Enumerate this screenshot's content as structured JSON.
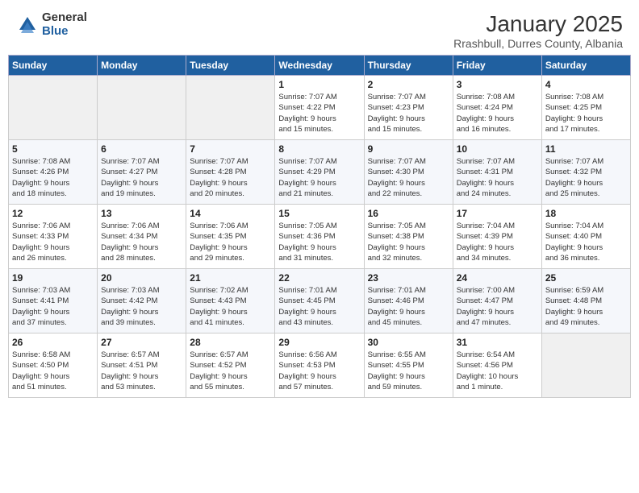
{
  "header": {
    "logo_general": "General",
    "logo_blue": "Blue",
    "month_title": "January 2025",
    "location": "Rrashbull, Durres County, Albania"
  },
  "days_of_week": [
    "Sunday",
    "Monday",
    "Tuesday",
    "Wednesday",
    "Thursday",
    "Friday",
    "Saturday"
  ],
  "weeks": [
    [
      {
        "num": "",
        "info": ""
      },
      {
        "num": "",
        "info": ""
      },
      {
        "num": "",
        "info": ""
      },
      {
        "num": "1",
        "info": "Sunrise: 7:07 AM\nSunset: 4:22 PM\nDaylight: 9 hours\nand 15 minutes."
      },
      {
        "num": "2",
        "info": "Sunrise: 7:07 AM\nSunset: 4:23 PM\nDaylight: 9 hours\nand 15 minutes."
      },
      {
        "num": "3",
        "info": "Sunrise: 7:08 AM\nSunset: 4:24 PM\nDaylight: 9 hours\nand 16 minutes."
      },
      {
        "num": "4",
        "info": "Sunrise: 7:08 AM\nSunset: 4:25 PM\nDaylight: 9 hours\nand 17 minutes."
      }
    ],
    [
      {
        "num": "5",
        "info": "Sunrise: 7:08 AM\nSunset: 4:26 PM\nDaylight: 9 hours\nand 18 minutes."
      },
      {
        "num": "6",
        "info": "Sunrise: 7:07 AM\nSunset: 4:27 PM\nDaylight: 9 hours\nand 19 minutes."
      },
      {
        "num": "7",
        "info": "Sunrise: 7:07 AM\nSunset: 4:28 PM\nDaylight: 9 hours\nand 20 minutes."
      },
      {
        "num": "8",
        "info": "Sunrise: 7:07 AM\nSunset: 4:29 PM\nDaylight: 9 hours\nand 21 minutes."
      },
      {
        "num": "9",
        "info": "Sunrise: 7:07 AM\nSunset: 4:30 PM\nDaylight: 9 hours\nand 22 minutes."
      },
      {
        "num": "10",
        "info": "Sunrise: 7:07 AM\nSunset: 4:31 PM\nDaylight: 9 hours\nand 24 minutes."
      },
      {
        "num": "11",
        "info": "Sunrise: 7:07 AM\nSunset: 4:32 PM\nDaylight: 9 hours\nand 25 minutes."
      }
    ],
    [
      {
        "num": "12",
        "info": "Sunrise: 7:06 AM\nSunset: 4:33 PM\nDaylight: 9 hours\nand 26 minutes."
      },
      {
        "num": "13",
        "info": "Sunrise: 7:06 AM\nSunset: 4:34 PM\nDaylight: 9 hours\nand 28 minutes."
      },
      {
        "num": "14",
        "info": "Sunrise: 7:06 AM\nSunset: 4:35 PM\nDaylight: 9 hours\nand 29 minutes."
      },
      {
        "num": "15",
        "info": "Sunrise: 7:05 AM\nSunset: 4:36 PM\nDaylight: 9 hours\nand 31 minutes."
      },
      {
        "num": "16",
        "info": "Sunrise: 7:05 AM\nSunset: 4:38 PM\nDaylight: 9 hours\nand 32 minutes."
      },
      {
        "num": "17",
        "info": "Sunrise: 7:04 AM\nSunset: 4:39 PM\nDaylight: 9 hours\nand 34 minutes."
      },
      {
        "num": "18",
        "info": "Sunrise: 7:04 AM\nSunset: 4:40 PM\nDaylight: 9 hours\nand 36 minutes."
      }
    ],
    [
      {
        "num": "19",
        "info": "Sunrise: 7:03 AM\nSunset: 4:41 PM\nDaylight: 9 hours\nand 37 minutes."
      },
      {
        "num": "20",
        "info": "Sunrise: 7:03 AM\nSunset: 4:42 PM\nDaylight: 9 hours\nand 39 minutes."
      },
      {
        "num": "21",
        "info": "Sunrise: 7:02 AM\nSunset: 4:43 PM\nDaylight: 9 hours\nand 41 minutes."
      },
      {
        "num": "22",
        "info": "Sunrise: 7:01 AM\nSunset: 4:45 PM\nDaylight: 9 hours\nand 43 minutes."
      },
      {
        "num": "23",
        "info": "Sunrise: 7:01 AM\nSunset: 4:46 PM\nDaylight: 9 hours\nand 45 minutes."
      },
      {
        "num": "24",
        "info": "Sunrise: 7:00 AM\nSunset: 4:47 PM\nDaylight: 9 hours\nand 47 minutes."
      },
      {
        "num": "25",
        "info": "Sunrise: 6:59 AM\nSunset: 4:48 PM\nDaylight: 9 hours\nand 49 minutes."
      }
    ],
    [
      {
        "num": "26",
        "info": "Sunrise: 6:58 AM\nSunset: 4:50 PM\nDaylight: 9 hours\nand 51 minutes."
      },
      {
        "num": "27",
        "info": "Sunrise: 6:57 AM\nSunset: 4:51 PM\nDaylight: 9 hours\nand 53 minutes."
      },
      {
        "num": "28",
        "info": "Sunrise: 6:57 AM\nSunset: 4:52 PM\nDaylight: 9 hours\nand 55 minutes."
      },
      {
        "num": "29",
        "info": "Sunrise: 6:56 AM\nSunset: 4:53 PM\nDaylight: 9 hours\nand 57 minutes."
      },
      {
        "num": "30",
        "info": "Sunrise: 6:55 AM\nSunset: 4:55 PM\nDaylight: 9 hours\nand 59 minutes."
      },
      {
        "num": "31",
        "info": "Sunrise: 6:54 AM\nSunset: 4:56 PM\nDaylight: 10 hours\nand 1 minute."
      },
      {
        "num": "",
        "info": ""
      }
    ]
  ]
}
